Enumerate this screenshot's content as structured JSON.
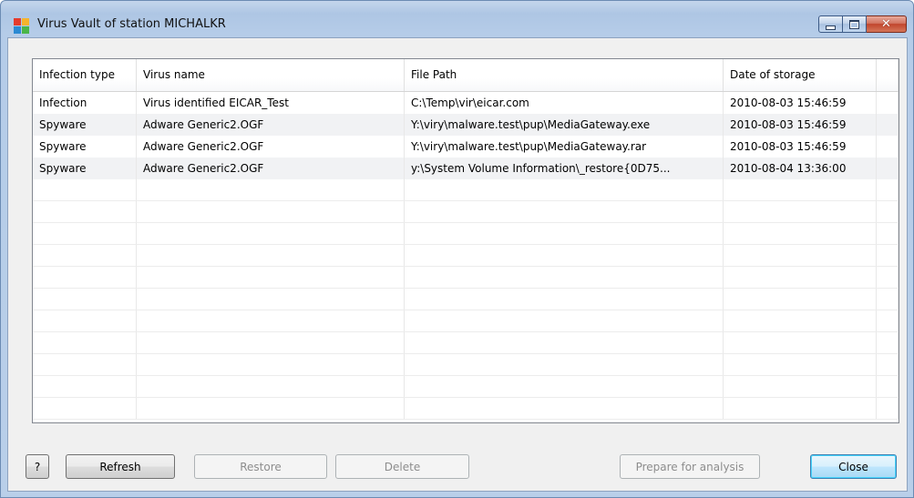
{
  "window": {
    "title": "Virus Vault of station MICHALKR",
    "icon": "avg-logo-icon",
    "controls": [
      "minimize",
      "maximize",
      "close"
    ]
  },
  "table": {
    "columns": [
      "Infection type",
      "Virus name",
      "File Path",
      "Date of storage"
    ],
    "rows": [
      [
        "Infection",
        "Virus identified EICAR_Test",
        "C:\\Temp\\vir\\eicar.com",
        "2010-08-03 15:46:59"
      ],
      [
        "Spyware",
        "Adware Generic2.OGF",
        "Y:\\viry\\malware.test\\pup\\MediaGateway.exe",
        "2010-08-03 15:46:59"
      ],
      [
        "Spyware",
        "Adware Generic2.OGF",
        "Y:\\viry\\malware.test\\pup\\MediaGateway.rar",
        "2010-08-03 15:46:59"
      ],
      [
        "Spyware",
        "Adware Generic2.OGF",
        "y:\\System Volume Information\\_restore{0D75...",
        "2010-08-04 13:36:00"
      ]
    ]
  },
  "buttons": {
    "help": "?",
    "refresh": "Refresh",
    "restore": "Restore",
    "delete": "Delete",
    "prepare": "Prepare for analysis",
    "close": "Close"
  },
  "colors": {
    "title_bar": "#b9cfe9",
    "close_button": "#c1452c",
    "alt_row": "#f1f2f4"
  }
}
